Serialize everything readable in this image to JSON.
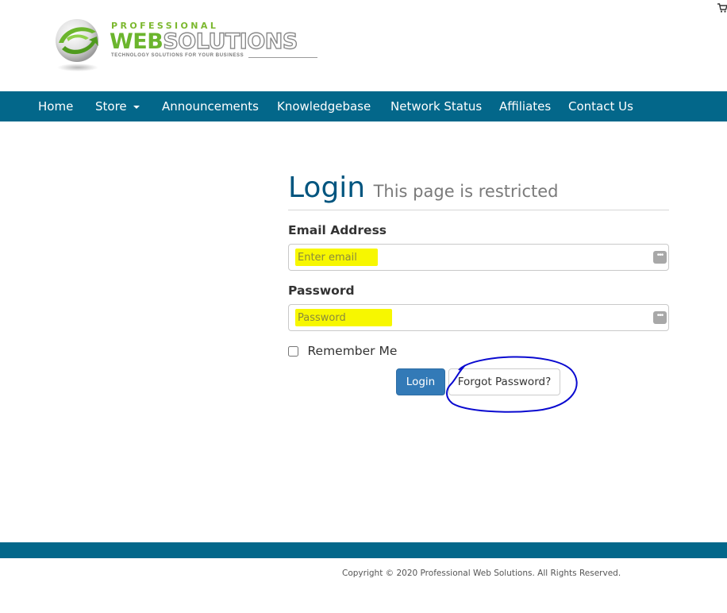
{
  "header": {
    "logo_top": "PROFESSIONAL",
    "logo_web": "WEB",
    "logo_solutions": "SOLUTIONS",
    "logo_tagline": "TECHNOLOGY SOLUTIONS FOR YOUR BUSINESS",
    "cart_icon": "shopping-cart-icon"
  },
  "nav": {
    "items": [
      {
        "label": "Home"
      },
      {
        "label": "Store",
        "has_dropdown": true
      },
      {
        "label": "Announcements"
      },
      {
        "label": "Knowledgebase"
      },
      {
        "label": "Network Status"
      },
      {
        "label": "Affiliates"
      },
      {
        "label": "Contact Us"
      }
    ]
  },
  "login": {
    "title": "Login",
    "subtitle": "This page is restricted",
    "email_label": "Email Address",
    "email_placeholder": "Enter email",
    "email_value": "",
    "password_label": "Password",
    "password_placeholder": "Password",
    "password_value": "",
    "remember_label": "Remember Me",
    "remember_checked": false,
    "login_button": "Login",
    "forgot_button": "Forgot Password?"
  },
  "annotations": {
    "highlight_color": "#f7f700",
    "circle_color": "#0a0ad0"
  },
  "footer": {
    "copyright": "Copyright © 2020 Professional Web Solutions. All Rights Reserved."
  },
  "colors": {
    "brand": "#03678a",
    "title": "#00557f",
    "primary_button": "#337ab7",
    "logo_green": "#6bb52d"
  }
}
